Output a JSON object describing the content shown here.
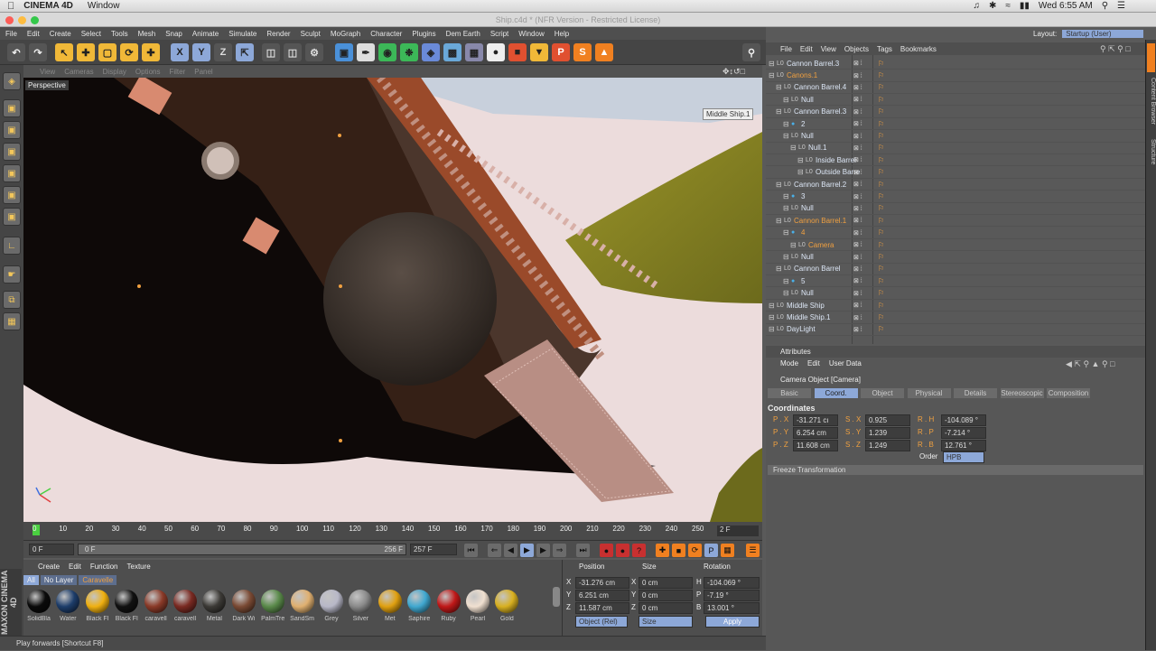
{
  "macos": {
    "apple": "",
    "app_name": "CINEMA 4D",
    "menu_window": "Window",
    "clock": "Wed 6:55 AM",
    "status_icons": [
      "battery-icon",
      "wifi-icon",
      "bluetooth-icon",
      "audio-icon"
    ]
  },
  "window_title": "Ship.c4d * (NFR Version - Restricted License)",
  "layout": {
    "label": "Layout:",
    "value": "Startup (User)"
  },
  "main_menu": [
    "File",
    "Edit",
    "Create",
    "Select",
    "Tools",
    "Mesh",
    "Snap",
    "Animate",
    "Simulate",
    "Render",
    "Sculpt",
    "MoGraph",
    "Character",
    "Plugins",
    "Dem Earth",
    "Script",
    "Window",
    "Help"
  ],
  "viewport": {
    "menu": [
      "View",
      "Cameras",
      "Display",
      "Options",
      "Filter",
      "Panel"
    ],
    "name": "Perspective",
    "camera_label": "Middle Ship.1"
  },
  "timeline": {
    "ticks": [
      "0",
      "10",
      "20",
      "30",
      "40",
      "50",
      "60",
      "70",
      "80",
      "90",
      "100",
      "110",
      "120",
      "130",
      "140",
      "150",
      "160",
      "170",
      "180",
      "190",
      "200",
      "210",
      "220",
      "230",
      "240",
      "250"
    ],
    "current_frame": "2 F"
  },
  "transport": {
    "start": "0 F",
    "range_start": "0 F",
    "range_end": "256 F",
    "end": "257 F"
  },
  "materials": {
    "menu": [
      "Create",
      "Edit",
      "Function",
      "Texture"
    ],
    "filters": [
      "All",
      "No Layer",
      "Caravelle"
    ],
    "items": [
      {
        "label": "SolidBla",
        "color": "#0a0a0a"
      },
      {
        "label": "Water",
        "color": "#1d3d6a"
      },
      {
        "label": "Black Fl",
        "color": "#f0b010"
      },
      {
        "label": "Black Fl",
        "color": "#111111"
      },
      {
        "label": "caravell",
        "color": "#8a3a28"
      },
      {
        "label": "caravell",
        "color": "#7a2a22"
      },
      {
        "label": "Metal",
        "color": "#3c3a36"
      },
      {
        "label": "Dark Wi",
        "color": "#7a4a34"
      },
      {
        "label": "PalmTre",
        "color": "#5a8a4a"
      },
      {
        "label": "SandSm",
        "color": "#e0b070"
      },
      {
        "label": "Grey",
        "color": "#b8b8c8"
      },
      {
        "label": "Silver",
        "color": "#8a8a8a"
      },
      {
        "label": "Met",
        "color": "#e0a010"
      },
      {
        "label": "Saphire",
        "color": "#40a8d0"
      },
      {
        "label": "Ruby",
        "color": "#c01818"
      },
      {
        "label": "Pearl",
        "color": "#f0e0d0"
      },
      {
        "label": "Gold",
        "color": "#d8b020"
      }
    ]
  },
  "coord_panel": {
    "headers": [
      "Position",
      "Size",
      "Rotation"
    ],
    "rows": [
      {
        "axis": "X",
        "pos": "-31.276 cm",
        "size_axis": "X",
        "size": "0 cm",
        "rot_axis": "H",
        "rot": "-104.069 °"
      },
      {
        "axis": "Y",
        "pos": "6.251 cm",
        "size_axis": "Y",
        "size": "0 cm",
        "rot_axis": "P",
        "rot": "-7.19 °"
      },
      {
        "axis": "Z",
        "pos": "11.587 cm",
        "size_axis": "Z",
        "size": "0 cm",
        "rot_axis": "B",
        "rot": "13.001 °"
      }
    ],
    "mode": "Object (Rel)",
    "size_mode": "Size",
    "apply": "Apply"
  },
  "status": "Play forwards [Shortcut F8]",
  "object_manager": {
    "menu": [
      "File",
      "Edit",
      "View",
      "Objects",
      "Tags",
      "Bookmarks"
    ],
    "objects": [
      {
        "name": "Cannon Barrel.3",
        "indent": 0,
        "hl": false
      },
      {
        "name": "Canons.1",
        "indent": 0,
        "hl": true
      },
      {
        "name": "Cannon Barrel.4",
        "indent": 1,
        "hl": false
      },
      {
        "name": "Null",
        "indent": 2,
        "hl": false
      },
      {
        "name": "Cannon Barrel.3",
        "indent": 1,
        "hl": false
      },
      {
        "name": "2",
        "indent": 2,
        "hl": false
      },
      {
        "name": "Null",
        "indent": 2,
        "hl": false
      },
      {
        "name": "Null.1",
        "indent": 3,
        "hl": false
      },
      {
        "name": "Inside Barrel",
        "indent": 4,
        "hl": false
      },
      {
        "name": "Outside Barre",
        "indent": 4,
        "hl": false
      },
      {
        "name": "Cannon Barrel.2",
        "indent": 1,
        "hl": false
      },
      {
        "name": "3",
        "indent": 2,
        "hl": false
      },
      {
        "name": "Null",
        "indent": 2,
        "hl": false
      },
      {
        "name": "Cannon Barrel.1",
        "indent": 1,
        "hl": true
      },
      {
        "name": "4",
        "indent": 2,
        "hl": true
      },
      {
        "name": "Camera",
        "indent": 3,
        "hl": true
      },
      {
        "name": "Null",
        "indent": 2,
        "hl": false
      },
      {
        "name": "Cannon Barrel",
        "indent": 1,
        "hl": false
      },
      {
        "name": "5",
        "indent": 2,
        "hl": false
      },
      {
        "name": "Null",
        "indent": 2,
        "hl": false
      },
      {
        "name": "Middle Ship",
        "indent": 0,
        "hl": false
      },
      {
        "name": "Middle Ship.1",
        "indent": 0,
        "hl": false
      },
      {
        "name": "DayLight",
        "indent": 0,
        "hl": false
      }
    ]
  },
  "attributes": {
    "title": "Attributes",
    "menu": [
      "Mode",
      "Edit",
      "User Data"
    ],
    "object": "Camera Object [Camera]",
    "tabs": [
      "Basic",
      "Coord.",
      "Object",
      "Physical",
      "Details",
      "Stereoscopic",
      "Composition"
    ],
    "section": "Coordinates",
    "rows": [
      {
        "p": "P . X",
        "pv": "-31.271 cı",
        "s": "S . X",
        "sv": "0.925",
        "r": "R . H",
        "rv": "-104.089 °"
      },
      {
        "p": "P . Y",
        "pv": "6.254 cm",
        "s": "S . Y",
        "sv": "1.239",
        "r": "R . P",
        "rv": "-7.214 °"
      },
      {
        "p": "P . Z",
        "pv": "11.608 cm",
        "s": "S . Z",
        "sv": "1.249",
        "r": "R . B",
        "rv": "12.761 °"
      }
    ],
    "order_label": "Order",
    "order_value": "HPB",
    "freeze": "Freeze Transformation"
  },
  "dock_tabs": [
    "Content Browser",
    "Structure"
  ]
}
